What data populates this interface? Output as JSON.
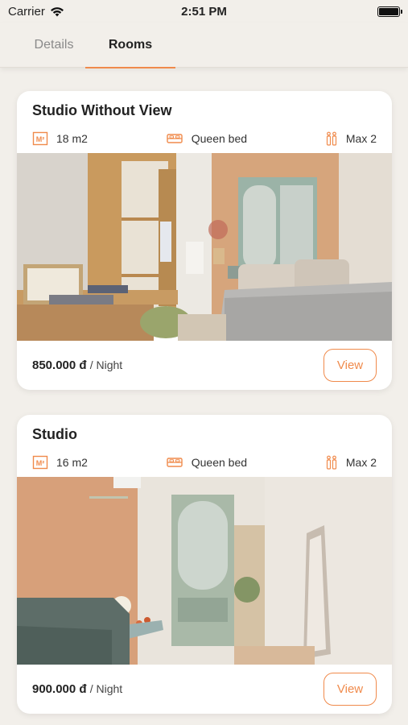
{
  "status_bar": {
    "carrier": "Carrier",
    "time": "2:51 PM"
  },
  "tabs": [
    {
      "label": "Details",
      "selected": false
    },
    {
      "label": "Rooms",
      "selected": true
    }
  ],
  "accent_color": "#f08a4b",
  "rooms": [
    {
      "title": "Studio Without View",
      "area": "18 m2",
      "bed": "Queen bed",
      "max_guests": "Max 2",
      "price": "850.000 đ",
      "price_unit": "/ Night",
      "view_label": "View"
    },
    {
      "title": "Studio",
      "area": "16 m2",
      "bed": "Queen bed",
      "max_guests": "Max 2",
      "price": "900.000 đ",
      "price_unit": "/ Night",
      "view_label": "View"
    }
  ],
  "icons": {
    "area": "area-m2-icon",
    "bed": "bed-icon",
    "guests": "guests-icon",
    "wifi": "wifi-icon",
    "battery": "battery-icon"
  }
}
